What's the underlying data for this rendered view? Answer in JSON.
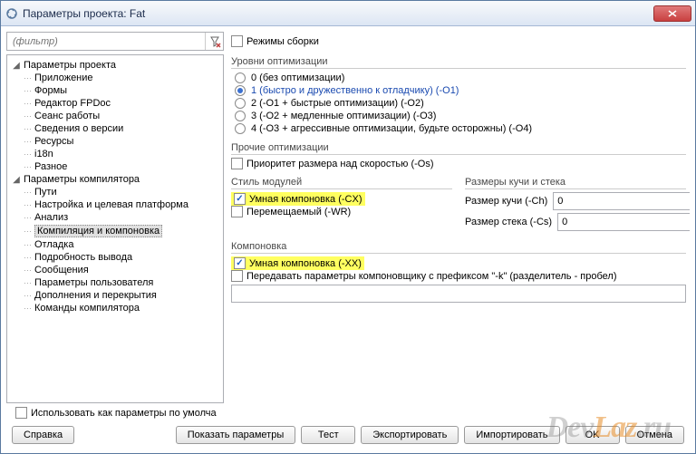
{
  "titlebar": {
    "title": "Параметры проекта: Fat"
  },
  "filter": {
    "placeholder": "(фильтр)"
  },
  "build_modes": {
    "label": "Режимы сборки"
  },
  "tree": {
    "g1": {
      "label": "Параметры проекта"
    },
    "g1_items": [
      "Приложение",
      "Формы",
      "Редактор FPDoc",
      "Сеанс работы",
      "Сведения о версии",
      "Ресурсы",
      "i18n",
      "Разное"
    ],
    "g2": {
      "label": "Параметры компилятора"
    },
    "g2_items": [
      "Пути",
      "Настройка и целевая платформа",
      "Анализ",
      "Компиляция и компоновка",
      "Отладка",
      "Подробность вывода",
      "Сообщения",
      "Параметры пользователя",
      "Дополнения и перекрытия",
      "Команды компилятора"
    ],
    "selected": "Компиляция и компоновка"
  },
  "opt": {
    "title": "Уровни оптимизации",
    "r0": "0 (без оптимизации)",
    "r1": "1 (быстро и дружественно к отладчику) (-O1)",
    "r2": "2 (-O1 + быстрые оптимизации) (-O2)",
    "r3": "3 (-O2 + медленные оптимизации) (-O3)",
    "r4": "4 (-O3 + агрессивные оптимизации, будьте осторожны) (-O4)"
  },
  "other_opt": {
    "title": "Прочие оптимизации",
    "size_priority": "Приоритет размера над скоростью (-Os)"
  },
  "unit_style": {
    "title": "Стиль модулей",
    "smart": "Умная компоновка (-CX)",
    "reloc": "Перемещаемый (-WR)"
  },
  "heap": {
    "title": "Размеры кучи и стека",
    "heap_label": "Размер кучи (-Ch)",
    "heap_value": "0",
    "stack_label": "Размер стека (-Cs)",
    "stack_value": "0"
  },
  "link": {
    "title": "Компоновка",
    "smart": "Умная компоновка (-XX)",
    "pass_k": "Передавать параметры компоновщику с префиксом \"-k\" (разделитель - пробел)"
  },
  "default_params": {
    "label": "Использовать как параметры по умолча"
  },
  "buttons": {
    "help": "Справка",
    "show": "Показать параметры",
    "test": "Тест",
    "export": "Экспортировать",
    "import": "Импортировать",
    "ok": "OK",
    "cancel": "Отмена"
  },
  "watermark": {
    "a": "Dev",
    "b": "Laz",
    "c": ".ru"
  }
}
